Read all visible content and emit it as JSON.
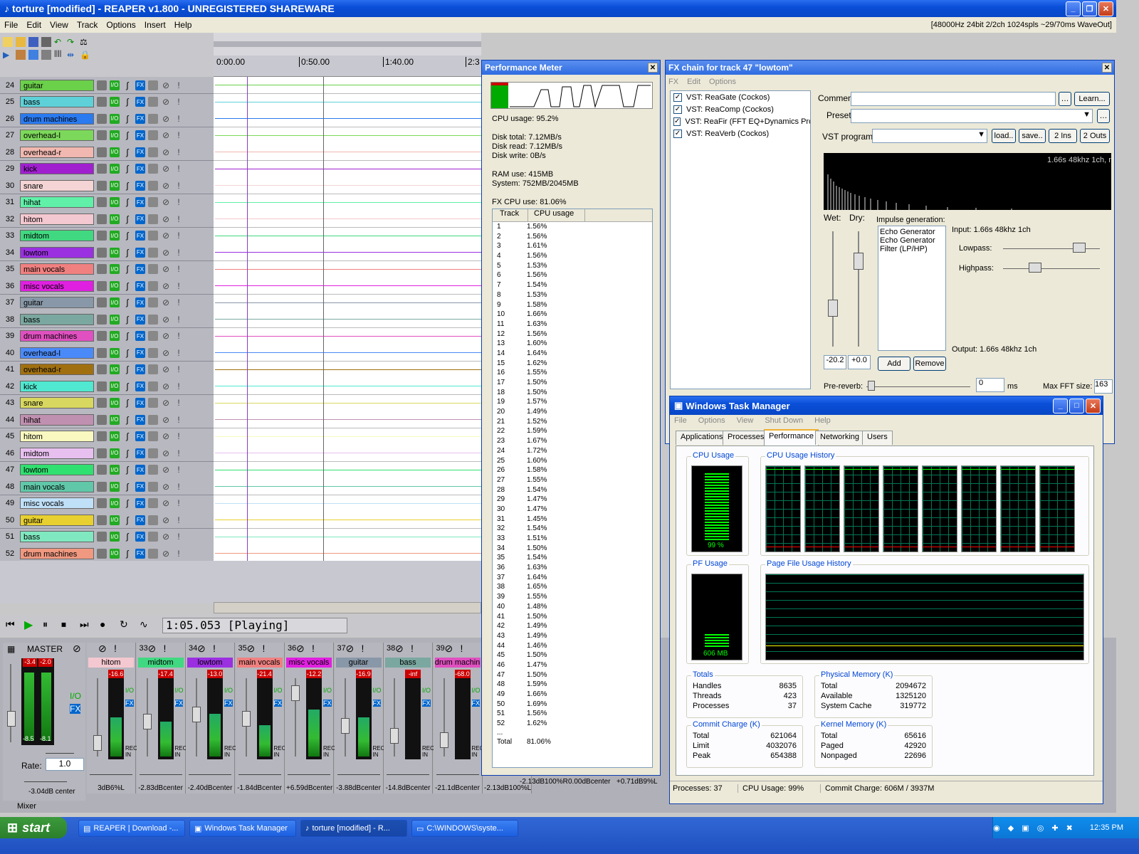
{
  "app": {
    "title": "torture [modified] - REAPER v1.800 - UNREGISTERED SHAREWARE",
    "status": "[48000Hz 24bit 2/2ch 1024spls ~29/70ms WaveOut]"
  },
  "menu": [
    "File",
    "Edit",
    "View",
    "Track",
    "Options",
    "Insert",
    "Help"
  ],
  "ruler": [
    "0:00.00",
    "0:50.00",
    "1:40.00",
    "2:3"
  ],
  "tracks": [
    {
      "n": "24",
      "name": "guitar",
      "color": "#6bd04a"
    },
    {
      "n": "25",
      "name": "bass",
      "color": "#5ed0d8"
    },
    {
      "n": "26",
      "name": "drum machines",
      "color": "#2a7af0"
    },
    {
      "n": "27",
      "name": "overhead-l",
      "color": "#7cd85a"
    },
    {
      "n": "28",
      "name": "overhead-r",
      "color": "#f0b8b0"
    },
    {
      "n": "29",
      "name": "kick",
      "color": "#a020d0"
    },
    {
      "n": "30",
      "name": "snare",
      "color": "#f4d4d4"
    },
    {
      "n": "31",
      "name": "hihat",
      "color": "#60f0a8"
    },
    {
      "n": "32",
      "name": "hitom",
      "color": "#f4c8d0"
    },
    {
      "n": "33",
      "name": "midtom",
      "color": "#40d880"
    },
    {
      "n": "34",
      "name": "lowtom",
      "color": "#9a30e0"
    },
    {
      "n": "35",
      "name": "main vocals",
      "color": "#f08080"
    },
    {
      "n": "36",
      "name": "misc vocals",
      "color": "#e020e0"
    },
    {
      "n": "37",
      "name": "guitar",
      "color": "#8898a8"
    },
    {
      "n": "38",
      "name": "bass",
      "color": "#7aa8a0"
    },
    {
      "n": "39",
      "name": "drum machines",
      "color": "#e050c0"
    },
    {
      "n": "40",
      "name": "overhead-l",
      "color": "#4a8af8"
    },
    {
      "n": "41",
      "name": "overhead-r",
      "color": "#a07010"
    },
    {
      "n": "42",
      "name": "kick",
      "color": "#50e8d0"
    },
    {
      "n": "43",
      "name": "snare",
      "color": "#d8d860"
    },
    {
      "n": "44",
      "name": "hihat",
      "color": "#c090b0"
    },
    {
      "n": "45",
      "name": "hitom",
      "color": "#f8f8c0"
    },
    {
      "n": "46",
      "name": "midtom",
      "color": "#e8c0f0"
    },
    {
      "n": "47",
      "name": "lowtom",
      "color": "#30e070"
    },
    {
      "n": "48",
      "name": "main vocals",
      "color": "#60c8a8"
    },
    {
      "n": "49",
      "name": "misc vocals",
      "color": "#c0e0f8"
    },
    {
      "n": "50",
      "name": "guitar",
      "color": "#e8d030"
    },
    {
      "n": "51",
      "name": "bass",
      "color": "#80e8c0"
    },
    {
      "n": "52",
      "name": "drum machines",
      "color": "#f09880"
    }
  ],
  "transport": {
    "time": "1:05.053 [Playing]"
  },
  "perf": {
    "title": "Performance Meter",
    "cpu": "CPU usage: 95.2%",
    "disk_total": "Disk total: 7.12MB/s",
    "disk_read": "Disk read: 7.12MB/s",
    "disk_write": "Disk write: 0B/s",
    "ram": "RAM use: 415MB",
    "system": "System: 752MB/2045MB",
    "fxcpu": "FX CPU use: 81.06%",
    "col_track": "Track",
    "col_cpu": "CPU usage",
    "rows": [
      [
        "1",
        "1.56%"
      ],
      [
        "2",
        "1.56%"
      ],
      [
        "3",
        "1.61%"
      ],
      [
        "4",
        "1.56%"
      ],
      [
        "5",
        "1.53%"
      ],
      [
        "6",
        "1.56%"
      ],
      [
        "7",
        "1.54%"
      ],
      [
        "8",
        "1.53%"
      ],
      [
        "9",
        "1.58%"
      ],
      [
        "10",
        "1.66%"
      ],
      [
        "11",
        "1.63%"
      ],
      [
        "12",
        "1.56%"
      ],
      [
        "13",
        "1.60%"
      ],
      [
        "14",
        "1.64%"
      ],
      [
        "15",
        "1.62%"
      ],
      [
        "16",
        "1.55%"
      ],
      [
        "17",
        "1.50%"
      ],
      [
        "18",
        "1.50%"
      ],
      [
        "19",
        "1.57%"
      ],
      [
        "20",
        "1.49%"
      ],
      [
        "21",
        "1.52%"
      ],
      [
        "22",
        "1.59%"
      ],
      [
        "23",
        "1.67%"
      ],
      [
        "24",
        "1.72%"
      ],
      [
        "25",
        "1.60%"
      ],
      [
        "26",
        "1.58%"
      ],
      [
        "27",
        "1.55%"
      ],
      [
        "28",
        "1.54%"
      ],
      [
        "29",
        "1.47%"
      ],
      [
        "30",
        "1.47%"
      ],
      [
        "31",
        "1.45%"
      ],
      [
        "32",
        "1.54%"
      ],
      [
        "33",
        "1.51%"
      ],
      [
        "34",
        "1.50%"
      ],
      [
        "35",
        "1.54%"
      ],
      [
        "36",
        "1.63%"
      ],
      [
        "37",
        "1.64%"
      ],
      [
        "38",
        "1.65%"
      ],
      [
        "39",
        "1.55%"
      ],
      [
        "40",
        "1.48%"
      ],
      [
        "41",
        "1.50%"
      ],
      [
        "42",
        "1.49%"
      ],
      [
        "43",
        "1.49%"
      ],
      [
        "44",
        "1.46%"
      ],
      [
        "45",
        "1.50%"
      ],
      [
        "46",
        "1.47%"
      ],
      [
        "47",
        "1.50%"
      ],
      [
        "48",
        "1.59%"
      ],
      [
        "49",
        "1.66%"
      ],
      [
        "50",
        "1.69%"
      ],
      [
        "51",
        "1.56%"
      ],
      [
        "52",
        "1.62%"
      ]
    ],
    "dots": "...",
    "total_label": "Total",
    "total_value": "81.06%"
  },
  "fx": {
    "title": "FX chain for track 47 \"lowtom\"",
    "menu": [
      "FX",
      "Edit",
      "Options"
    ],
    "plugins": [
      "VST: ReaGate (Cockos)",
      "VST: ReaComp (Cockos)",
      "VST: ReaFir (FFT EQ+Dynamics Proc",
      "VST: ReaVerb (Cockos)"
    ],
    "comment": "Comment:",
    "learn": "Learn...",
    "preset": "Preset:",
    "vstprog": "VST program:",
    "load": "load..",
    "save": "save..",
    "ins": "2 Ins",
    "outs": "2 Outs",
    "info": "1.66s 48khz 1ch, r",
    "wet": "Wet:",
    "dry": "Dry:",
    "impulse": "Impulse generation:",
    "gens": [
      "Echo Generator",
      "Echo Generator",
      "Filter (LP/HP)"
    ],
    "input": "Input: 1.66s 48khz 1ch",
    "lowpass": "Lowpass:",
    "highpass": "Highpass:",
    "output": "Output: 1.66s 48khz 1ch",
    "wetval": "-20.2",
    "dryval": "+0.0",
    "add": "Add",
    "remove": "Remove",
    "prereverb": "Pre-reverb:",
    "prereverb_val": "0",
    "ms": "ms",
    "maxfft": "Max FFT size:",
    "maxfft_val": "163"
  },
  "tm": {
    "title": "Windows Task Manager",
    "menu": [
      "File",
      "Options",
      "View",
      "Shut Down",
      "Help"
    ],
    "tabs": [
      "Applications",
      "Processes",
      "Performance",
      "Networking",
      "Users"
    ],
    "cpu_usage": "CPU Usage",
    "cpu_hist": "CPU Usage History",
    "cpu_val": "99 %",
    "pf_usage": "PF Usage",
    "pf_hist": "Page File Usage History",
    "pf_val": "606 MB",
    "totals": {
      "label": "Totals",
      "rows": [
        [
          "Handles",
          "8635"
        ],
        [
          "Threads",
          "423"
        ],
        [
          "Processes",
          "37"
        ]
      ]
    },
    "phys": {
      "label": "Physical Memory (K)",
      "rows": [
        [
          "Total",
          "2094672"
        ],
        [
          "Available",
          "1325120"
        ],
        [
          "System Cache",
          "319772"
        ]
      ]
    },
    "commit": {
      "label": "Commit Charge (K)",
      "rows": [
        [
          "Total",
          "621064"
        ],
        [
          "Limit",
          "4032076"
        ],
        [
          "Peak",
          "654388"
        ]
      ]
    },
    "kernel": {
      "label": "Kernel Memory (K)",
      "rows": [
        [
          "Total",
          "65616"
        ],
        [
          "Paged",
          "42920"
        ],
        [
          "Nonpaged",
          "22696"
        ]
      ]
    },
    "status": [
      "Processes: 37",
      "CPU Usage: 99%",
      "Commit Charge: 606M / 3937M"
    ]
  },
  "mixer": {
    "label": "Mixer",
    "master": "MASTER",
    "master_l": "-3.4",
    "master_r": "-2.0",
    "master_bl": "-8.5",
    "master_br": "-8.1",
    "rate_label": "Rate:",
    "rate": "1.0",
    "master_pan": "-3.04dB center",
    "strips": [
      {
        "n": "",
        "name": "hitom",
        "color": "#f4c8d0",
        "peak": "-16.6",
        "pan": "3dB6%L"
      },
      {
        "n": "33",
        "name": "midtom",
        "color": "#40d880",
        "peak": "-17.4",
        "pan": "-2.83dBcenter"
      },
      {
        "n": "34",
        "name": "lowtom",
        "color": "#9a30e0",
        "peak": "-13.0",
        "pan": "-2.40dBcenter"
      },
      {
        "n": "35",
        "name": "main vocals",
        "color": "#f08080",
        "peak": "-21.4",
        "pan": "-1.84dBcenter"
      },
      {
        "n": "36",
        "name": "misc vocals",
        "color": "#e020e0",
        "peak": "-12.2",
        "pan": "+6.59dBcenter"
      },
      {
        "n": "37",
        "name": "guitar",
        "color": "#8898a8",
        "peak": "-16.9",
        "pan": "-3.88dBcenter"
      },
      {
        "n": "38",
        "name": "bass",
        "color": "#7aa8a0",
        "peak": "-inf",
        "pan": "-14.8dBcenter"
      },
      {
        "n": "39",
        "name": "drum machin",
        "color": "#e050c0",
        "peak": "-68.0",
        "pan": "-21.1dBcenter"
      },
      {
        "n": "4",
        "name": "o",
        "color": "#4a8af8",
        "peak": "",
        "pan": "-2.13dB100%L"
      }
    ],
    "extra_pans": [
      "-2.13dB100%R",
      "0.00dBcenter",
      "+0.71dB9%L"
    ]
  },
  "taskbar": {
    "start": "start",
    "items": [
      "REAPER | Download -...",
      "Windows Task Manager",
      "torture [modified] - R...",
      "C:\\WINDOWS\\syste..."
    ],
    "clock": "12:35 PM"
  }
}
